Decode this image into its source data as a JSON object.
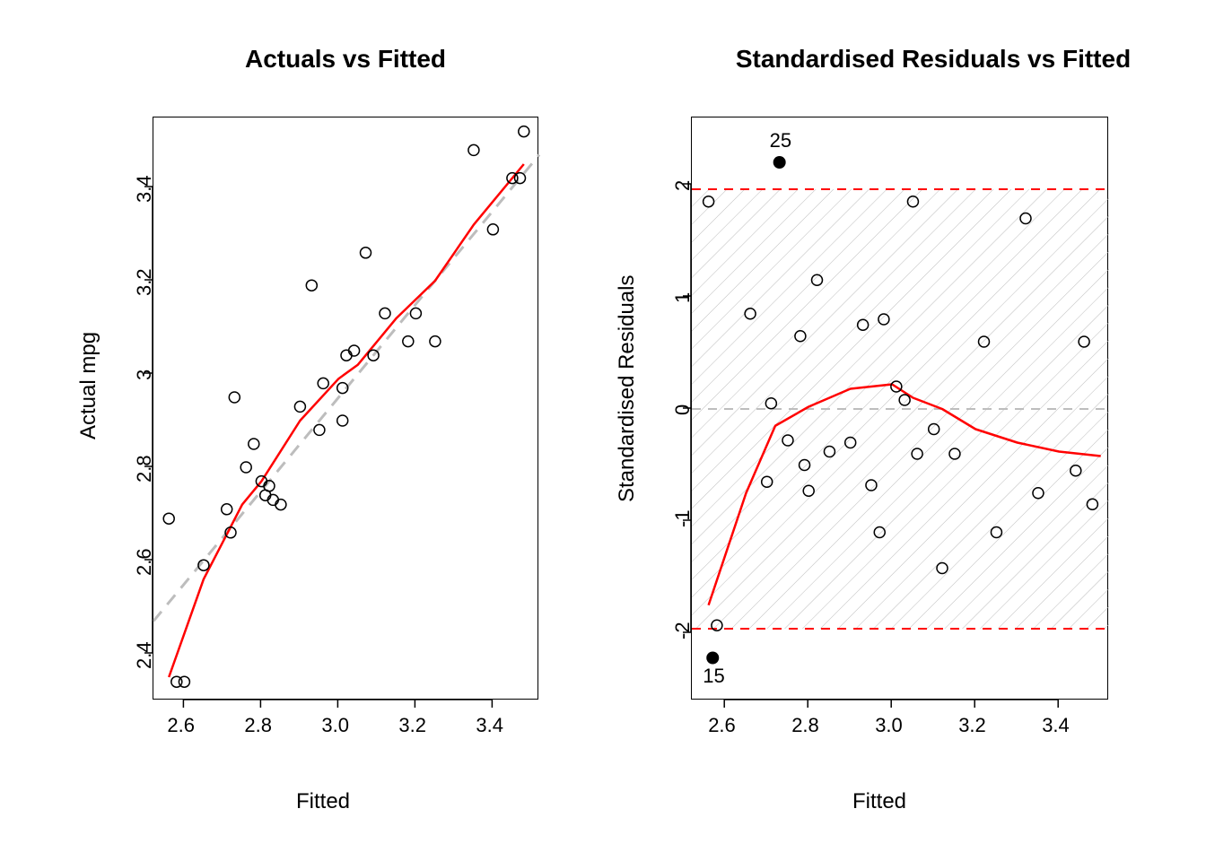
{
  "chart_data": [
    {
      "type": "scatter",
      "title": "Actuals vs Fitted",
      "xlabel": "Fitted",
      "ylabel": "Actual mpg",
      "xlim": [
        2.52,
        3.52
      ],
      "ylim": [
        2.3,
        3.55
      ],
      "xticks": [
        2.6,
        2.8,
        3.0,
        3.2,
        3.4
      ],
      "yticks": [
        2.4,
        2.6,
        2.8,
        3.0,
        3.2,
        3.4
      ],
      "points": [
        {
          "x": 2.56,
          "y": 2.69
        },
        {
          "x": 2.58,
          "y": 2.34
        },
        {
          "x": 2.6,
          "y": 2.34
        },
        {
          "x": 2.65,
          "y": 2.59
        },
        {
          "x": 2.71,
          "y": 2.71
        },
        {
          "x": 2.72,
          "y": 2.66
        },
        {
          "x": 2.76,
          "y": 2.8
        },
        {
          "x": 2.73,
          "y": 2.95
        },
        {
          "x": 2.78,
          "y": 2.85
        },
        {
          "x": 2.8,
          "y": 2.77
        },
        {
          "x": 2.81,
          "y": 2.74
        },
        {
          "x": 2.82,
          "y": 2.76
        },
        {
          "x": 2.83,
          "y": 2.73
        },
        {
          "x": 2.85,
          "y": 2.72
        },
        {
          "x": 2.9,
          "y": 2.93
        },
        {
          "x": 2.95,
          "y": 2.88
        },
        {
          "x": 2.96,
          "y": 2.98
        },
        {
          "x": 2.93,
          "y": 3.19
        },
        {
          "x": 3.01,
          "y": 2.97
        },
        {
          "x": 3.01,
          "y": 2.9
        },
        {
          "x": 3.02,
          "y": 3.04
        },
        {
          "x": 3.04,
          "y": 3.05
        },
        {
          "x": 3.09,
          "y": 3.04
        },
        {
          "x": 3.07,
          "y": 3.26
        },
        {
          "x": 3.12,
          "y": 3.13
        },
        {
          "x": 3.18,
          "y": 3.07
        },
        {
          "x": 3.2,
          "y": 3.13
        },
        {
          "x": 3.25,
          "y": 3.07
        },
        {
          "x": 3.35,
          "y": 3.48
        },
        {
          "x": 3.4,
          "y": 3.31
        },
        {
          "x": 3.45,
          "y": 3.42
        },
        {
          "x": 3.47,
          "y": 3.42
        },
        {
          "x": 3.48,
          "y": 3.52
        }
      ],
      "reference_line": {
        "type": "dashed",
        "color": "#bdbdbd",
        "from": [
          2.52,
          2.47
        ],
        "to": [
          3.52,
          3.47
        ]
      },
      "smooth_line": {
        "color": "red",
        "path": [
          {
            "x": 2.56,
            "y": 2.35
          },
          {
            "x": 2.65,
            "y": 2.56
          },
          {
            "x": 2.75,
            "y": 2.72
          },
          {
            "x": 2.8,
            "y": 2.77
          },
          {
            "x": 2.9,
            "y": 2.9
          },
          {
            "x": 3.0,
            "y": 2.99
          },
          {
            "x": 3.05,
            "y": 3.02
          },
          {
            "x": 3.15,
            "y": 3.12
          },
          {
            "x": 3.25,
            "y": 3.2
          },
          {
            "x": 3.35,
            "y": 3.32
          },
          {
            "x": 3.48,
            "y": 3.45
          }
        ]
      }
    },
    {
      "type": "scatter",
      "title": "Standardised Residuals vs Fitted",
      "xlabel": "Fitted",
      "ylabel": "Standardised Residuals",
      "xlim": [
        2.52,
        3.52
      ],
      "ylim": [
        -2.6,
        2.6
      ],
      "xticks": [
        2.6,
        2.8,
        3.0,
        3.2,
        3.4
      ],
      "yticks": [
        -2,
        -1,
        0,
        1,
        2
      ],
      "hatch_band": {
        "ymin": -1.96,
        "ymax": 1.96
      },
      "hlines": [
        {
          "y": 1.96,
          "style": "dashed",
          "color": "red"
        },
        {
          "y": 0.0,
          "style": "dashed",
          "color": "#bdbdbd"
        },
        {
          "y": -1.96,
          "style": "dashed",
          "color": "red"
        }
      ],
      "points": [
        {
          "x": 2.56,
          "y": 1.85
        },
        {
          "x": 2.58,
          "y": -1.93
        },
        {
          "x": 2.66,
          "y": 0.85
        },
        {
          "x": 2.7,
          "y": -0.65
        },
        {
          "x": 2.71,
          "y": 0.05
        },
        {
          "x": 2.75,
          "y": -0.28
        },
        {
          "x": 2.78,
          "y": 0.65
        },
        {
          "x": 2.79,
          "y": -0.5
        },
        {
          "x": 2.8,
          "y": -0.73
        },
        {
          "x": 2.82,
          "y": 1.15
        },
        {
          "x": 2.85,
          "y": -0.38
        },
        {
          "x": 2.9,
          "y": -0.3
        },
        {
          "x": 2.93,
          "y": 0.75
        },
        {
          "x": 2.95,
          "y": -0.68
        },
        {
          "x": 2.97,
          "y": -1.1
        },
        {
          "x": 2.98,
          "y": 0.8
        },
        {
          "x": 3.01,
          "y": 0.2
        },
        {
          "x": 3.03,
          "y": 0.08
        },
        {
          "x": 3.05,
          "y": 1.85
        },
        {
          "x": 3.06,
          "y": -0.4
        },
        {
          "x": 3.1,
          "y": -0.18
        },
        {
          "x": 3.12,
          "y": -1.42
        },
        {
          "x": 3.15,
          "y": -0.4
        },
        {
          "x": 3.22,
          "y": 0.6
        },
        {
          "x": 3.25,
          "y": -1.1
        },
        {
          "x": 3.32,
          "y": 1.7
        },
        {
          "x": 3.35,
          "y": -0.75
        },
        {
          "x": 3.44,
          "y": -0.55
        },
        {
          "x": 3.46,
          "y": 0.6
        },
        {
          "x": 3.48,
          "y": -0.85
        }
      ],
      "outliers": [
        {
          "x": 2.73,
          "y": 2.2,
          "label": "25",
          "label_pos": "above"
        },
        {
          "x": 2.57,
          "y": -2.22,
          "label": "15",
          "label_pos": "below"
        }
      ],
      "smooth_line": {
        "color": "red",
        "path": [
          {
            "x": 2.56,
            "y": -1.75
          },
          {
            "x": 2.65,
            "y": -0.75
          },
          {
            "x": 2.72,
            "y": -0.15
          },
          {
            "x": 2.8,
            "y": 0.02
          },
          {
            "x": 2.9,
            "y": 0.18
          },
          {
            "x": 3.0,
            "y": 0.22
          },
          {
            "x": 3.05,
            "y": 0.1
          },
          {
            "x": 3.12,
            "y": 0.0
          },
          {
            "x": 3.2,
            "y": -0.18
          },
          {
            "x": 3.3,
            "y": -0.3
          },
          {
            "x": 3.4,
            "y": -0.38
          },
          {
            "x": 3.5,
            "y": -0.42
          }
        ]
      }
    }
  ]
}
